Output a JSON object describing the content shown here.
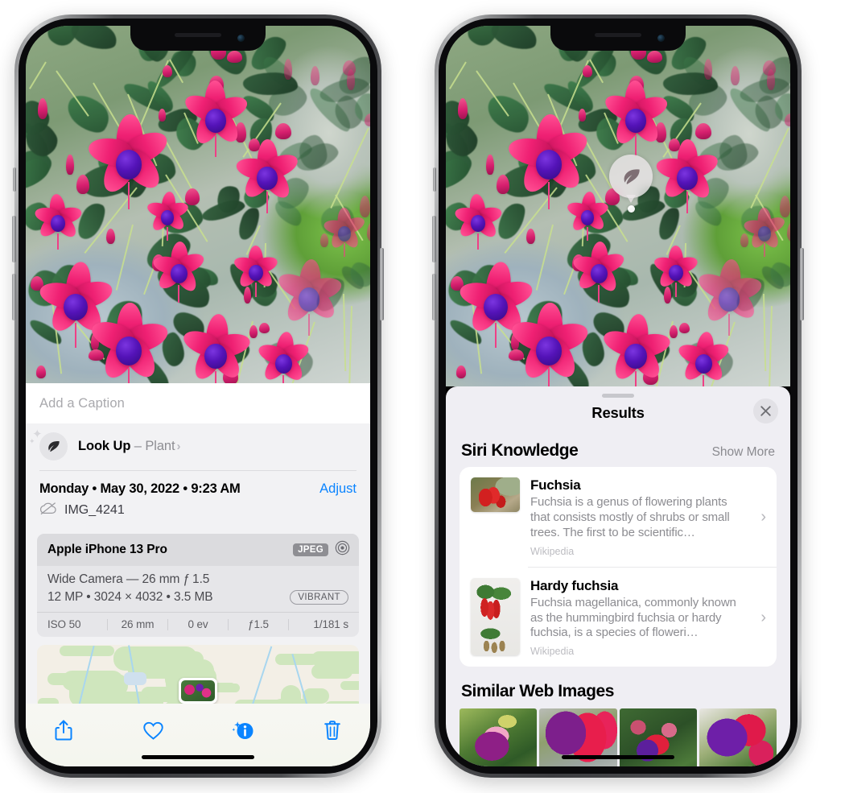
{
  "left_phone": {
    "photo_alt": "fuchsia-flowers-hanging-basket",
    "caption_field": {
      "placeholder": "Add a Caption",
      "value": ""
    },
    "look_up": {
      "icon": "leaf-icon",
      "label": "Look Up",
      "dash": "–",
      "subject": "Plant",
      "chevron": "›"
    },
    "metadata": {
      "date": "Monday • May 30, 2022 • 9:23 AM",
      "adjust_label": "Adjust",
      "cloud_icon": "icloud-slash-icon",
      "filename": "IMG_4241"
    },
    "exif": {
      "device": "Apple iPhone 13 Pro",
      "format_badge": "JPEG",
      "aperture_icon": "lens-icon",
      "lens_line": "Wide Camera — 26 mm ƒ 1.5",
      "specs_line": "12 MP • 3024 × 4032 • 3.5 MB",
      "style_badge": "VIBRANT",
      "stats": [
        "ISO 50",
        "26 mm",
        "0 ev",
        "ƒ1.5",
        "1/181 s"
      ]
    },
    "map": {
      "alt": "location-map-with-photo-pin"
    },
    "toolbar": [
      {
        "name": "share-button",
        "icon": "share-icon"
      },
      {
        "name": "favorite-button",
        "icon": "heart-icon"
      },
      {
        "name": "info-button",
        "icon": "info-sparkle-icon"
      },
      {
        "name": "delete-button",
        "icon": "trash-icon"
      }
    ],
    "accent_color": "#0a84ff"
  },
  "right_phone": {
    "photo_alt": "fuchsia-flowers-hanging-basket",
    "visual_lookup_badge": {
      "icon": "leaf-icon",
      "label": ""
    },
    "sheet": {
      "title": "Results",
      "close_label": "✕",
      "siri_knowledge": {
        "section_title": "Siri Knowledge",
        "show_more": "Show More",
        "items": [
          {
            "title": "Fuchsia",
            "description": "Fuchsia is a genus of flowering plants that consists mostly of shrubs or small trees. The first to be scientific…",
            "source": "Wikipedia",
            "thumb_alt": "red-fuchsia-flowers-photo",
            "chevron": "›"
          },
          {
            "title": "Hardy fuchsia",
            "description": "Fuchsia magellanica, commonly known as the hummingbird fuchsia or hardy fuchsia, is a species of floweri…",
            "source": "Wikipedia",
            "thumb_alt": "hardy-fuchsia-specimen-photo",
            "chevron": "›"
          }
        ]
      },
      "similar_web_images": {
        "section_title": "Similar Web Images",
        "thumbs": [
          {
            "alt": "fuchsia-pink-purple-leaves"
          },
          {
            "alt": "fuchsia-red-closeup"
          },
          {
            "alt": "fuchsia-bush-buds"
          },
          {
            "alt": "fuchsia-purple-magenta-cluster"
          }
        ]
      }
    }
  }
}
